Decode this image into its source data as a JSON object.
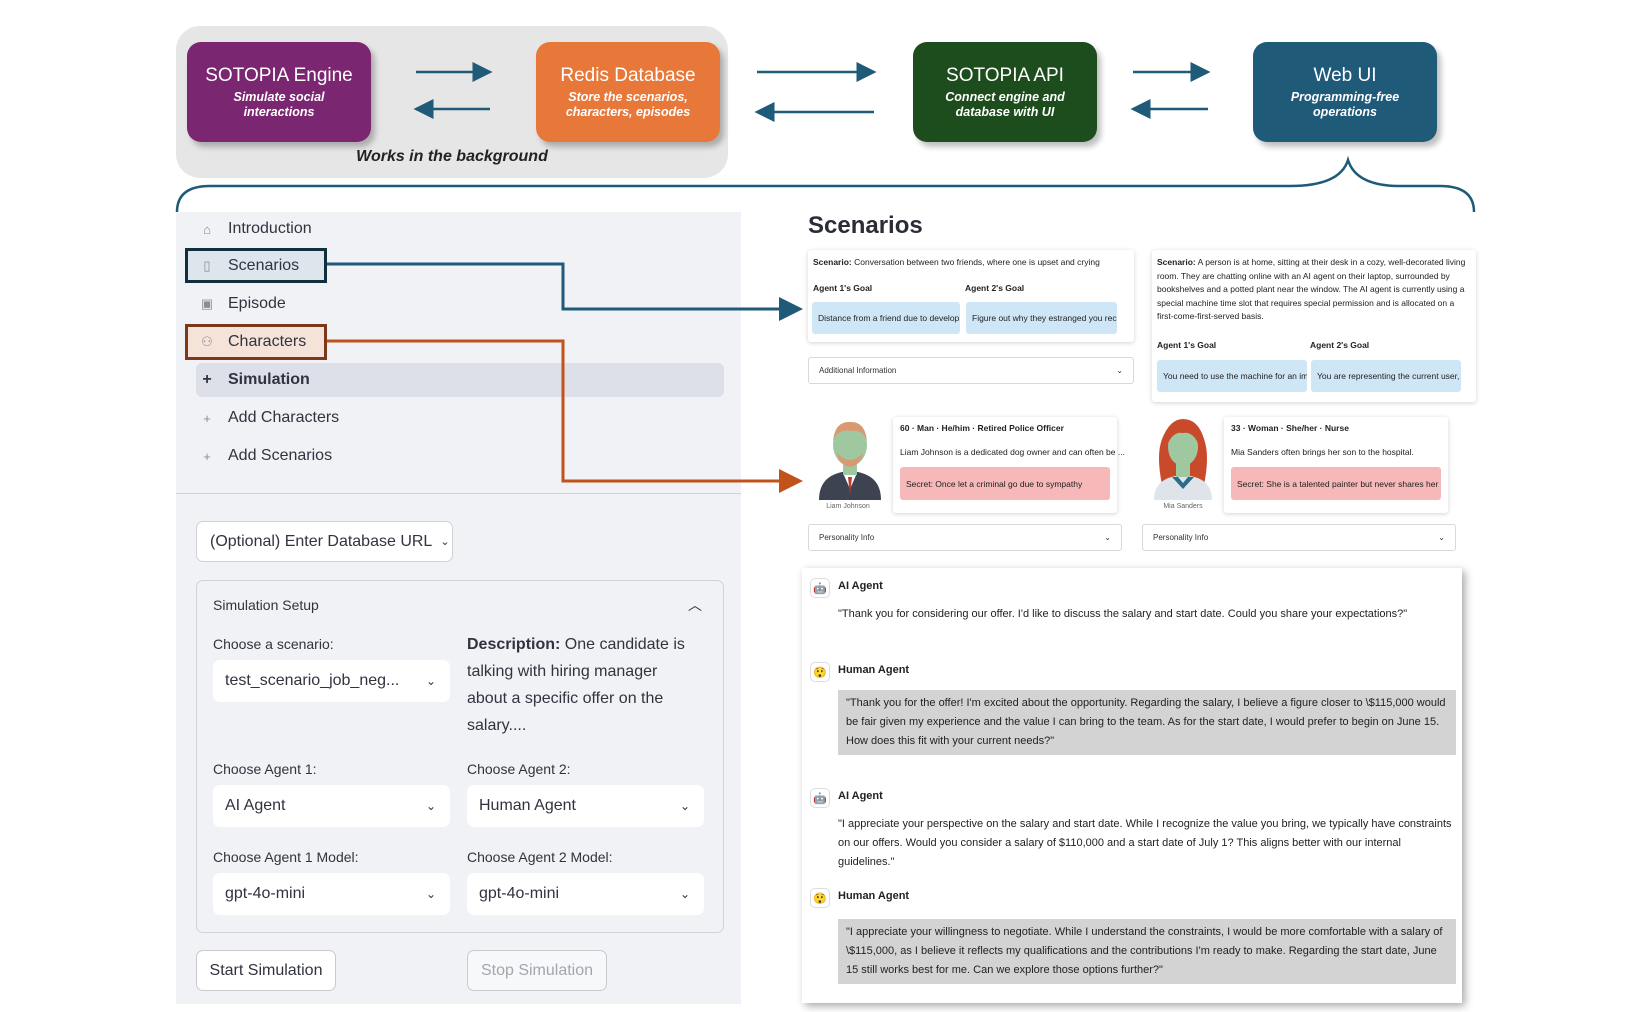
{
  "architecture": {
    "engine": {
      "title": "SOTOPIA Engine",
      "subtitle": "Simulate social interactions",
      "color": "#7b2670"
    },
    "redis": {
      "title": "Redis Database",
      "subtitle": "Store the scenarios, characters, episodes",
      "color": "#e8783a"
    },
    "api": {
      "title": "SOTOPIA API",
      "subtitle": "Connect engine and database with UI",
      "color": "#1e4d1d"
    },
    "webui": {
      "title": "Web UI",
      "subtitle": "Programming-free operations",
      "color": "#1f5a79"
    },
    "background_caption": "Works in the background"
  },
  "sidebar": {
    "items": [
      {
        "label": "Introduction",
        "icon": "home-icon"
      },
      {
        "label": "Scenarios",
        "icon": "document-icon"
      },
      {
        "label": "Episode",
        "icon": "gallery-icon"
      },
      {
        "label": "Characters",
        "icon": "people-icon"
      },
      {
        "label": "Simulation",
        "icon": "plus-icon"
      },
      {
        "label": "Add Characters",
        "icon": "plus-icon"
      },
      {
        "label": "Add Scenarios",
        "icon": "plus-icon"
      }
    ]
  },
  "setup": {
    "db_url_placeholder": "(Optional) Enter Database URL",
    "title": "Simulation Setup",
    "scenario_label": "Choose a scenario:",
    "scenario_value": "test_scenario_job_neg...",
    "description_label": "Description:",
    "description_text": "One candidate is talking with hiring manager about a specific offer on the salary....",
    "agent1_label": "Choose Agent 1:",
    "agent1_value": "AI Agent",
    "agent2_label": "Choose Agent 2:",
    "agent2_value": "Human Agent",
    "model1_label": "Choose Agent 1 Model:",
    "model1_value": "gpt-4o-mini",
    "model2_label": "Choose Agent 2 Model:",
    "model2_value": "gpt-4o-mini",
    "start_button": "Start Simulation",
    "stop_button": "Stop Simulation"
  },
  "scenarios_view": {
    "title": "Scenarios",
    "scenario1": {
      "label": "Scenario:",
      "text": "Conversation between two friends, where one is upset and crying",
      "goal1_label": "Agent 1's Goal",
      "goal1": "Distance from a friend due to develop",
      "goal2_label": "Agent 2's Goal",
      "goal2": "Figure out why they estranged you rec",
      "additional": "Additional Information"
    },
    "scenario2": {
      "label": "Scenario:",
      "text": "A person is at home, sitting at their desk in a cozy, well-decorated living room. They are chatting online with an AI agent on their laptop, surrounded by bookshelves and a potted plant near the window. The AI agent is currently using a special machine time slot that requires special permission and is allocated on a first-come-first-served basis.",
      "goal1_label": "Agent 1's Goal",
      "goal1": "You need to use the machine for an im",
      "goal2_label": "Agent 2's Goal",
      "goal2": "You are representing the current user,"
    },
    "character1": {
      "meta": "60 · Man · He/him · Retired Police Officer",
      "bio": "Liam Johnson is a dedicated dog owner and can often be ...",
      "secret": "Secret: Once let a criminal go due to sympathy",
      "name": "Liam Johnson",
      "personality": "Personality Info"
    },
    "character2": {
      "meta": "33 · Woman · She/her · Nurse",
      "bio": "Mia Sanders often brings her son to the hospital.",
      "secret": "Secret: She is a talented painter but never shares her ...",
      "name": "Mia Sanders",
      "personality": "Personality Info"
    }
  },
  "chat": {
    "messages": [
      {
        "speaker": "AI Agent",
        "text": "\"Thank you for considering our offer. I'd like to discuss the salary and start date. Could you share your expectations?\""
      },
      {
        "speaker": "Human Agent",
        "text": "\"Thank you for the offer! I'm excited about the opportunity. Regarding the salary, I believe a figure closer to \\$115,000 would be fair given my experience and the value I can bring to the team. As for the start date, I would prefer to begin on June 15. How does this fit with your current needs?\""
      },
      {
        "speaker": "AI Agent",
        "text": "\"I appreciate your perspective on the salary and start date. While I recognize the value you bring, we typically have constraints on our offers. Would you consider a salary of $110,000 and a start date of July 1? This aligns better with our internal guidelines.\""
      },
      {
        "speaker": "Human Agent",
        "text": "\"I appreciate your willingness to negotiate. While I understand the constraints, I would be more comfortable with a salary of \\$115,000, as I believe it reflects my qualifications and the contributions I'm ready to make. Regarding the start date, June 15 still works best for me. Can we explore those options further?\""
      }
    ]
  }
}
